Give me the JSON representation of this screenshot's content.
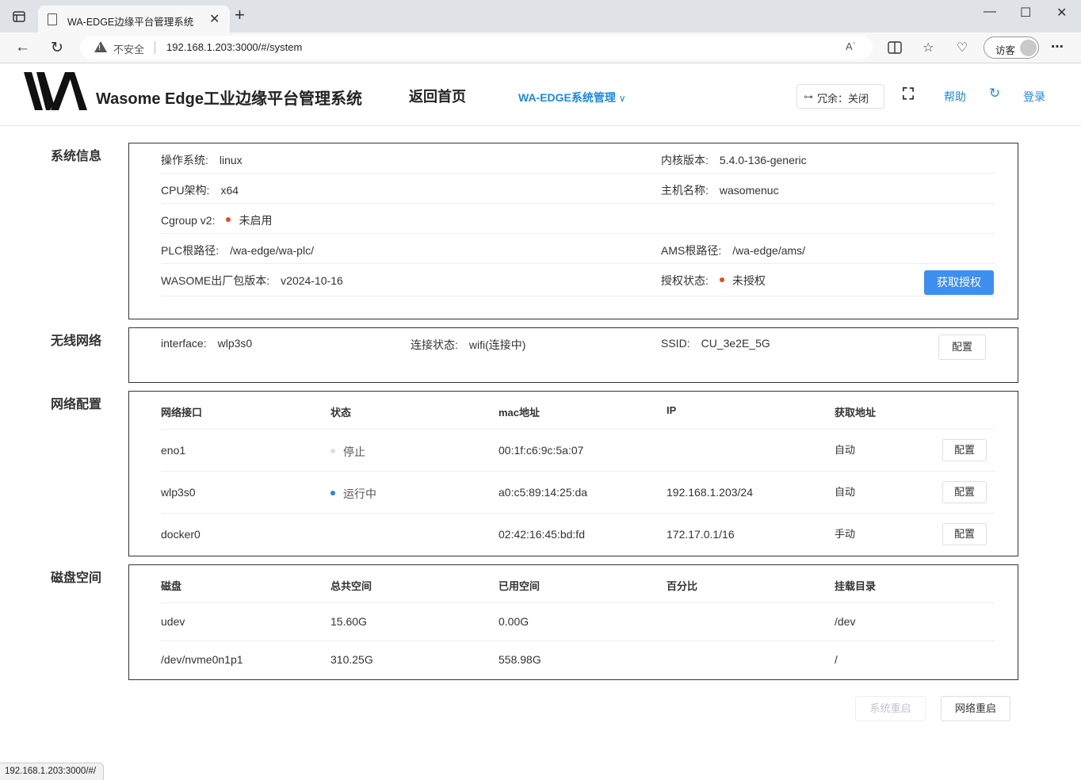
{
  "browser": {
    "tab_title": "WA-EDGE边缘平台管理系统",
    "tab_close": "✕",
    "new_tab": "+",
    "minimize": "—",
    "maximize": "☐",
    "close": "✕",
    "back": "←",
    "reload": "↻",
    "insecure_label": "不安全",
    "url": "192.168.1.203:3000/#/system",
    "read_aloud": "Aʾ",
    "guest_label": "访客",
    "status_url": "192.168.1.203:3000/#/"
  },
  "header": {
    "app_title": "Wasome Edge工业边缘平台管理系统",
    "home_link": "返回首页",
    "system_menu": "WA-EDGE系统管理",
    "redundancy_label": "冗余：关闭",
    "help": "帮助",
    "login": "登录",
    "brand_color": "#1e88e5"
  },
  "system_info": {
    "section_label": "系统信息",
    "os_label": "操作系统:",
    "os_value": "linux",
    "kernel_label": "内核版本:",
    "kernel_value": "5.4.0-136-generic",
    "cpu_label": "CPU架构:",
    "cpu_value": "x64",
    "host_label": "主机名称:",
    "host_value": "wasomenuc",
    "cgroup_label": "Cgroup v2:",
    "cgroup_value": "未启用",
    "plc_label": "PLC根路径:",
    "plc_value": "/wa-edge/wa-plc/",
    "ams_label": "AMS根路径:",
    "ams_value": "/wa-edge/ams/",
    "pkg_label": "WASOME出厂包版本:",
    "pkg_value": "v2024-10-16",
    "license_label": "授权状态:",
    "license_value": "未授权",
    "get_license_button": "获取授权"
  },
  "wireless": {
    "section_label": "无线网络",
    "interface_label": "interface:",
    "interface_value": "wlp3s0",
    "conn_label": "连接状态:",
    "conn_value": "wifi(连接中)",
    "ssid_label": "SSID:",
    "ssid_value": "CU_3e2E_5G",
    "config_button": "配置"
  },
  "network": {
    "section_label": "网络配置",
    "columns": [
      "网络接口",
      "状态",
      "mac地址",
      "IP",
      "获取地址"
    ],
    "rows": [
      {
        "iface": "eno1",
        "status": "停止",
        "mac": "00:1f:c6:9c:5a:07",
        "ip": "",
        "mode": "自动",
        "button": "配置"
      },
      {
        "iface": "wlp3s0",
        "status": "运行中",
        "mac": "a0:c5:89:14:25:da",
        "ip": "192.168.1.203/24",
        "mode": "自动",
        "button": "配置"
      },
      {
        "iface": "docker0",
        "status": "",
        "mac": "02:42:16:45:bd:fd",
        "ip": "172.17.0.1/16",
        "mode": "手动",
        "button": "配置"
      }
    ]
  },
  "disk": {
    "section_label": "磁盘空间",
    "columns": [
      "磁盘",
      "总共空间",
      "已用空间",
      "百分比",
      "挂载目录"
    ],
    "rows": [
      {
        "disk": "udev",
        "total": "15.60G",
        "used": "0.00G",
        "percent": "",
        "mount": "/dev"
      },
      {
        "disk": "/dev/nvme0n1p1",
        "total": "310.25G",
        "used": "558.98G",
        "percent": "",
        "mount": "/"
      }
    ]
  },
  "actions": {
    "system_restart": "系统重启",
    "network_restart": "网络重启"
  }
}
